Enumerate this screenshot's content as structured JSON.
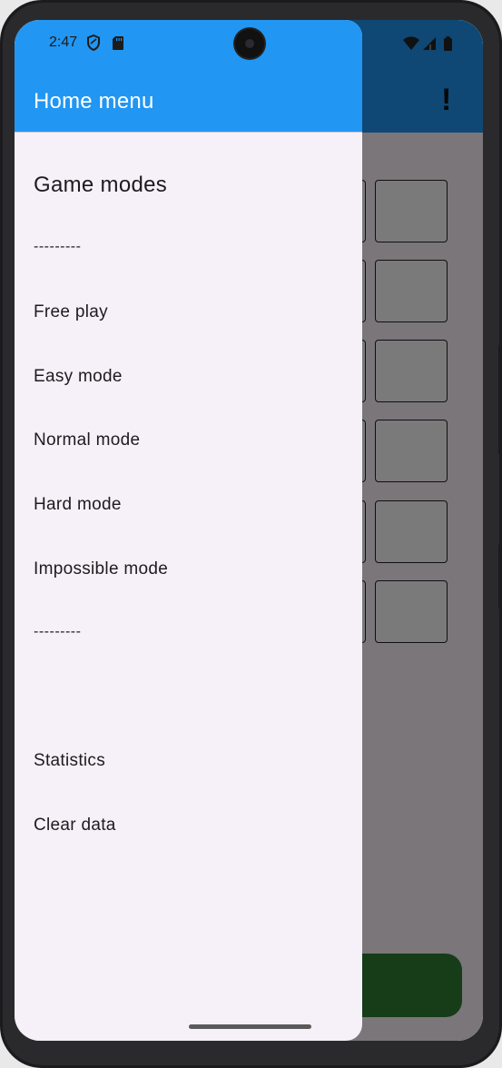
{
  "status_bar": {
    "time": "2:47",
    "left_icons": [
      "shield-icon",
      "sd-card-icon"
    ],
    "right_icons": [
      "wifi-icon",
      "signal-icon",
      "battery-icon"
    ]
  },
  "app": {
    "info_icon_glyph": "!",
    "app_bar_color": "#2196f3",
    "submit_color": "#2e7d32"
  },
  "drawer": {
    "title": "Home menu",
    "section_title": "Game modes",
    "divider_top": "---------",
    "modes": [
      {
        "label": "Free play"
      },
      {
        "label": "Easy mode"
      },
      {
        "label": "Normal mode"
      },
      {
        "label": "Hard mode"
      },
      {
        "label": "Impossible mode"
      }
    ],
    "divider_bottom": "---------",
    "statistics_label": "Statistics",
    "clear_data_label": "Clear data"
  }
}
